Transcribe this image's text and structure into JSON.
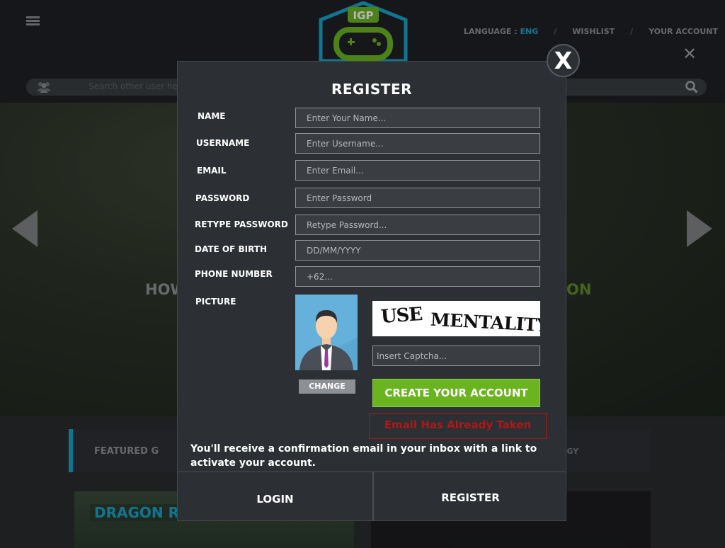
{
  "header": {
    "logo_text": "IGP",
    "language_label": "LANGUAGE : ",
    "language_value": "ENG",
    "separator": "/",
    "wishlist": "WISHLIST",
    "account": "YOUR ACCOUNT",
    "search_placeholder": "Search other user here..."
  },
  "hero": {
    "tag_left": "HOW",
    "tag_right": "ON"
  },
  "tabs": {
    "featured": "FEATURED G",
    "strategy": "EGY"
  },
  "cards": {
    "left_title": "DRAGON R"
  },
  "modal": {
    "close_label": "X",
    "title": "REGISTER",
    "fields": [
      {
        "label": "NAME",
        "placeholder": "Enter Your Name..."
      },
      {
        "label": "USERNAME",
        "placeholder": "Enter Username..."
      },
      {
        "label": "EMAIL",
        "placeholder": "Enter Email..."
      },
      {
        "label": "PASSWORD",
        "placeholder": "Enter Password"
      },
      {
        "label": "RETYPE PASSWORD",
        "placeholder": "Retype Password..."
      },
      {
        "label": "DATE OF BIRTH",
        "placeholder": "DD/MM/YYYY"
      },
      {
        "label": "PHONE NUMBER",
        "placeholder": "+62..."
      }
    ],
    "picture_label": "PICTURE",
    "change_button": "CHANGE",
    "captcha_word1": "USE",
    "captcha_word2": "MENTALITY",
    "captcha_placeholder": "Insert Captcha...",
    "create_button": "CREATE YOUR ACCOUNT",
    "error_message": "Email Has Already Taken",
    "notice": "You'll receive a confirmation email in your inbox with a link to activate your account.",
    "footer_login": "LOGIN",
    "footer_register": "REGISTER"
  },
  "colors": {
    "accent_blue": "#1aa3c8",
    "accent_green": "#6ab420",
    "error_red": "#b01818"
  }
}
